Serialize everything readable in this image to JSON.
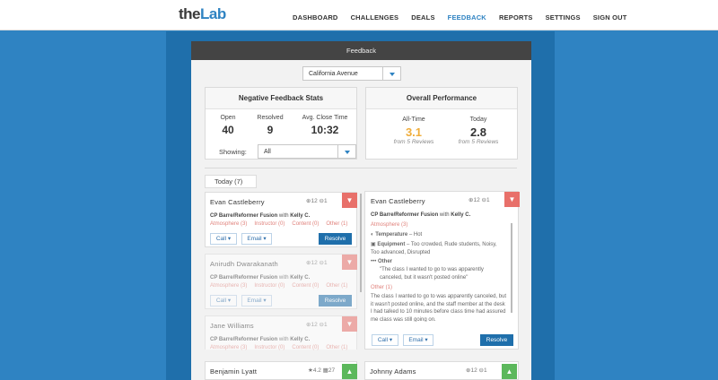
{
  "nav": {
    "logo_the": "the",
    "logo_lab": "Lab",
    "items": [
      "DASHBOARD",
      "CHALLENGES",
      "DEALS",
      "FEEDBACK",
      "REPORTS",
      "SETTINGS",
      "SIGN OUT"
    ],
    "active": "FEEDBACK"
  },
  "panel": {
    "title": "Feedback",
    "location": "California Avenue"
  },
  "neg": {
    "title": "Negative Feedback Stats",
    "open_label": "Open",
    "open": "40",
    "resolved_label": "Resolved",
    "resolved": "9",
    "close_label": "Avg. Close Time",
    "close": "10:32",
    "showing_label": "Showing:",
    "showing_value": "All"
  },
  "perf": {
    "title": "Overall Performance",
    "alltime_label": "All-Time",
    "alltime": "3.1",
    "alltime_sub": "from 5 Reviews",
    "today_label": "Today",
    "today": "2.8",
    "today_sub": "from 5 Reviews"
  },
  "tab": {
    "label": "Today (7)"
  },
  "items": [
    {
      "name": "Evan Castleberry",
      "up": "12",
      "down": "1",
      "class": "CP Barre/Reformer Fusion",
      "with": "with",
      "instructor": "Kelly C.",
      "tags": [
        "Atmosphere (3)",
        "Instructor (0)",
        "Content (0)",
        "Other (1)"
      ],
      "call": "Call",
      "email": "Email",
      "resolve": "Resolve"
    },
    {
      "name": "Anirudh Dwarakanath",
      "up": "12",
      "down": "1",
      "class": "CP Barre/Reformer Fusion",
      "with": "with",
      "instructor": "Kelly C.",
      "tags": [
        "Atmosphere (3)",
        "Instructor (0)",
        "Content (0)",
        "Other (1)"
      ],
      "call": "Call",
      "email": "Email",
      "resolve": "Resolve"
    },
    {
      "name": "Jane Williams",
      "up": "12",
      "down": "1",
      "class": "CP Barre/Reformer Fusion",
      "with": "with",
      "instructor": "Kelly C.",
      "tags": [
        "Atmosphere (3)",
        "Instructor (0)",
        "Content (0)",
        "Other (1)"
      ]
    }
  ],
  "detail": {
    "name": "Evan Castleberry",
    "up": "12",
    "down": "1",
    "class": "CP Barre/Reformer Fusion",
    "with": "with",
    "instructor": "Kelly C.",
    "atm_header": "Atmosphere (3)",
    "temp_label": "Temperature",
    "temp_val": "– Hot",
    "equip_label": "Equipment",
    "equip_val": "– Too crowded, Rude students, Noisy, Too advanced, Disrupted",
    "other_label": "Other",
    "other_quote": "\"The class I wanted to go to was apparently canceled, but it wasn't posted online\"",
    "other_header": "Other (1)",
    "other_text": "The class I wanted to go to was apparently canceled, but it wasn't posted online, and the staff member at the desk I had talked to 10 minutes before class time had assured me class was still going on.",
    "call": "Call",
    "email": "Email",
    "resolve": "Resolve"
  },
  "bottom": [
    {
      "name": "Benjamin Lyatt",
      "rating": "4.2",
      "count": "27"
    },
    {
      "name": "Johnny Adams",
      "up": "12",
      "down": "1"
    }
  ]
}
